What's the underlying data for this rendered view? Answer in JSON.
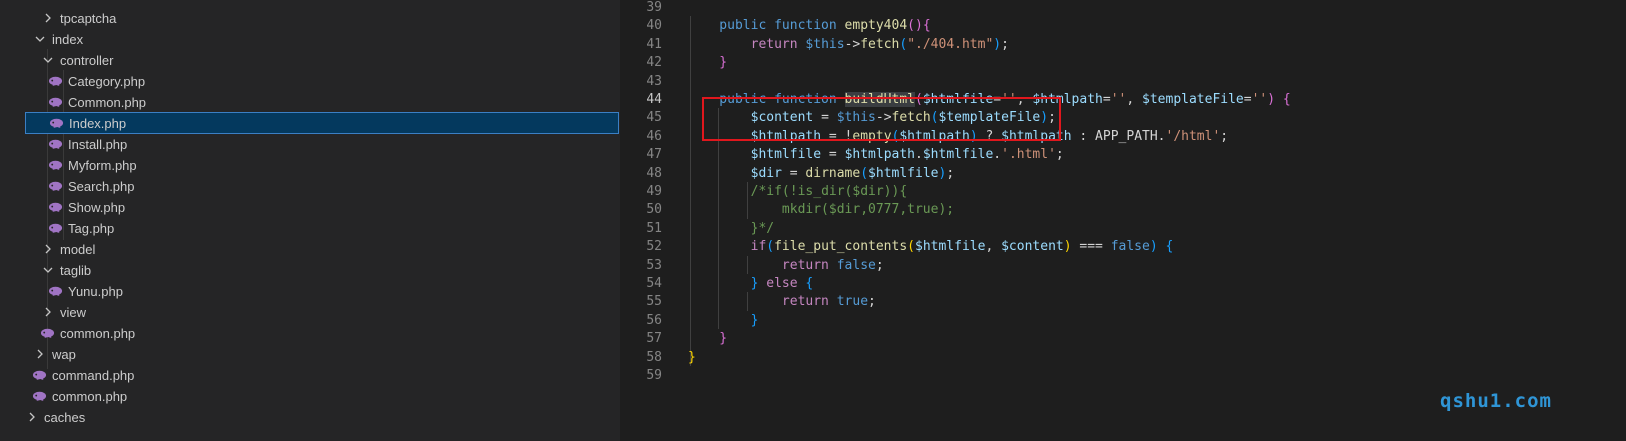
{
  "explorer": {
    "items": [
      {
        "label": "tpcaptcha",
        "type": "folder",
        "expanded": false
      },
      {
        "label": "index",
        "type": "folder",
        "expanded": true
      },
      {
        "label": "controller",
        "type": "folder",
        "expanded": true
      },
      {
        "label": "Category.php",
        "type": "file"
      },
      {
        "label": "Common.php",
        "type": "file"
      },
      {
        "label": "Index.php",
        "type": "file",
        "selected": true
      },
      {
        "label": "Install.php",
        "type": "file"
      },
      {
        "label": "Myform.php",
        "type": "file"
      },
      {
        "label": "Search.php",
        "type": "file"
      },
      {
        "label": "Show.php",
        "type": "file"
      },
      {
        "label": "Tag.php",
        "type": "file"
      },
      {
        "label": "model",
        "type": "folder",
        "expanded": false
      },
      {
        "label": "taglib",
        "type": "folder",
        "expanded": true
      },
      {
        "label": "Yunu.php",
        "type": "file"
      },
      {
        "label": "view",
        "type": "folder",
        "expanded": false
      },
      {
        "label": "common.php",
        "type": "file"
      },
      {
        "label": "wap",
        "type": "folder",
        "expanded": false
      },
      {
        "label": "command.php",
        "type": "file"
      },
      {
        "label": "common.php",
        "type": "file"
      },
      {
        "label": "caches",
        "type": "folder",
        "expanded": false
      }
    ]
  },
  "editor": {
    "line_numbers": [
      "39",
      "40",
      "41",
      "42",
      "43",
      "44",
      "45",
      "46",
      "47",
      "48",
      "49",
      "50",
      "51",
      "52",
      "53",
      "54",
      "55",
      "56",
      "57",
      "58",
      "59"
    ],
    "active_line": "44",
    "lines": [
      [],
      [
        {
          "t": "    public function ",
          "c": "kw"
        },
        {
          "t": "empty404",
          "c": "fn"
        },
        {
          "t": "(){",
          "c": "br1"
        }
      ],
      [
        {
          "t": "        ",
          "c": "punc"
        },
        {
          "t": "return ",
          "c": "ctrl"
        },
        {
          "t": "$this",
          "c": "kw"
        },
        {
          "t": "->",
          "c": "punc"
        },
        {
          "t": "fetch",
          "c": "fn"
        },
        {
          "t": "(",
          "c": "br2"
        },
        {
          "t": "\"./404.htm\"",
          "c": "str"
        },
        {
          "t": ")",
          "c": "br2"
        },
        {
          "t": ";",
          "c": "punc"
        }
      ],
      [
        {
          "t": "    }",
          "c": "br1"
        }
      ],
      [],
      [
        {
          "t": "    public function ",
          "c": "kw"
        },
        {
          "t": "buildHtml",
          "c": "fn hl"
        },
        {
          "t": "(",
          "c": "br1"
        },
        {
          "t": "$htmlfile",
          "c": "var"
        },
        {
          "t": "=",
          "c": "punc"
        },
        {
          "t": "''",
          "c": "str"
        },
        {
          "t": ", ",
          "c": "punc"
        },
        {
          "t": "$htmlpath",
          "c": "var"
        },
        {
          "t": "=",
          "c": "punc"
        },
        {
          "t": "''",
          "c": "str"
        },
        {
          "t": ", ",
          "c": "punc"
        },
        {
          "t": "$templateFile",
          "c": "var"
        },
        {
          "t": "=",
          "c": "punc"
        },
        {
          "t": "''",
          "c": "str"
        },
        {
          "t": ") ",
          "c": "br1"
        },
        {
          "t": "{",
          "c": "br1"
        }
      ],
      [
        {
          "t": "        ",
          "c": "punc"
        },
        {
          "t": "$content",
          "c": "var"
        },
        {
          "t": " = ",
          "c": "punc"
        },
        {
          "t": "$this",
          "c": "kw"
        },
        {
          "t": "->",
          "c": "punc"
        },
        {
          "t": "fetch",
          "c": "fn"
        },
        {
          "t": "(",
          "c": "br2"
        },
        {
          "t": "$templateFile",
          "c": "var"
        },
        {
          "t": ")",
          "c": "br2"
        },
        {
          "t": ";",
          "c": "punc"
        }
      ],
      [
        {
          "t": "        ",
          "c": "punc"
        },
        {
          "t": "$htmlpath",
          "c": "var"
        },
        {
          "t": " = !",
          "c": "punc"
        },
        {
          "t": "empty",
          "c": "fn"
        },
        {
          "t": "(",
          "c": "br2"
        },
        {
          "t": "$htmlpath",
          "c": "var"
        },
        {
          "t": ")",
          "c": "br2"
        },
        {
          "t": " ? ",
          "c": "punc"
        },
        {
          "t": "$htmlpath",
          "c": "var"
        },
        {
          "t": " : APP_PATH.",
          "c": "punc"
        },
        {
          "t": "'/html'",
          "c": "str"
        },
        {
          "t": ";",
          "c": "punc"
        }
      ],
      [
        {
          "t": "        ",
          "c": "punc"
        },
        {
          "t": "$htmlfile",
          "c": "var"
        },
        {
          "t": " = ",
          "c": "punc"
        },
        {
          "t": "$htmlpath",
          "c": "var"
        },
        {
          "t": ".",
          "c": "punc"
        },
        {
          "t": "$htmlfile",
          "c": "var"
        },
        {
          "t": ".",
          "c": "punc"
        },
        {
          "t": "'.html'",
          "c": "str"
        },
        {
          "t": ";",
          "c": "punc"
        }
      ],
      [
        {
          "t": "        ",
          "c": "punc"
        },
        {
          "t": "$dir",
          "c": "var"
        },
        {
          "t": " = ",
          "c": "punc"
        },
        {
          "t": "dirname",
          "c": "fn"
        },
        {
          "t": "(",
          "c": "br2"
        },
        {
          "t": "$htmlfile",
          "c": "var"
        },
        {
          "t": ")",
          "c": "br2"
        },
        {
          "t": ";",
          "c": "punc"
        }
      ],
      [
        {
          "t": "        ",
          "c": "punc"
        },
        {
          "t": "/*if(!is_dir($dir)){",
          "c": "cm"
        }
      ],
      [
        {
          "t": "            ",
          "c": "punc"
        },
        {
          "t": "mkdir($dir,0777,true);",
          "c": "cm"
        }
      ],
      [
        {
          "t": "        ",
          "c": "punc"
        },
        {
          "t": "}*/",
          "c": "cm"
        }
      ],
      [
        {
          "t": "        ",
          "c": "punc"
        },
        {
          "t": "if",
          "c": "ctrl"
        },
        {
          "t": "(",
          "c": "br2"
        },
        {
          "t": "file_put_contents",
          "c": "fn"
        },
        {
          "t": "(",
          "c": "br0"
        },
        {
          "t": "$htmlfile",
          "c": "var"
        },
        {
          "t": ", ",
          "c": "punc"
        },
        {
          "t": "$content",
          "c": "var"
        },
        {
          "t": ")",
          "c": "br0"
        },
        {
          "t": " === ",
          "c": "punc"
        },
        {
          "t": "false",
          "c": "kw"
        },
        {
          "t": ")",
          "c": "br2"
        },
        {
          "t": " {",
          "c": "br2"
        }
      ],
      [
        {
          "t": "            ",
          "c": "punc"
        },
        {
          "t": "return ",
          "c": "ctrl"
        },
        {
          "t": "false",
          "c": "kw"
        },
        {
          "t": ";",
          "c": "punc"
        }
      ],
      [
        {
          "t": "        ",
          "c": "punc"
        },
        {
          "t": "}",
          "c": "br2"
        },
        {
          "t": " ",
          "c": "punc"
        },
        {
          "t": "else",
          "c": "ctrl"
        },
        {
          "t": " ",
          "c": "punc"
        },
        {
          "t": "{",
          "c": "br2"
        }
      ],
      [
        {
          "t": "            ",
          "c": "punc"
        },
        {
          "t": "return ",
          "c": "ctrl"
        },
        {
          "t": "true",
          "c": "kw"
        },
        {
          "t": ";",
          "c": "punc"
        }
      ],
      [
        {
          "t": "        ",
          "c": "punc"
        },
        {
          "t": "}",
          "c": "br2"
        }
      ],
      [
        {
          "t": "    }",
          "c": "br1"
        }
      ],
      [
        {
          "t": "}",
          "c": "br0"
        }
      ],
      []
    ]
  },
  "watermark": "qshu1.com",
  "colors": {
    "highlight_box": "#e0171d",
    "watermark": "#2f95d6",
    "selection": "#04395e"
  }
}
